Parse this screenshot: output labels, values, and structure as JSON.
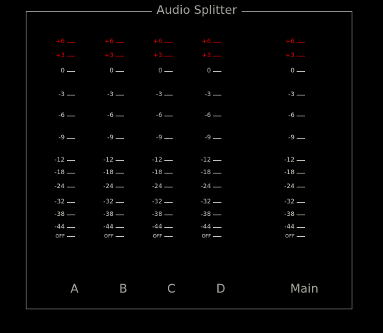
{
  "title": "Audio Splitter",
  "colors": {
    "background": "#000000",
    "frame": "#8f8f8f",
    "scale_text": "#c8c8c0",
    "peak_red": "#e00000",
    "label_text": "#a8a8a0"
  },
  "scale": [
    {
      "label": "+6",
      "red": true
    },
    {
      "label": "+3",
      "red": true
    },
    {
      "label": "0",
      "red": false
    },
    {
      "label": "-3",
      "red": false
    },
    {
      "label": "-6",
      "red": false
    },
    {
      "label": "-9",
      "red": false
    },
    {
      "label": "-12",
      "red": false
    },
    {
      "label": "-18",
      "red": false
    },
    {
      "label": "-24",
      "red": false
    },
    {
      "label": "-32",
      "red": false
    },
    {
      "label": "-38",
      "red": false
    },
    {
      "label": "-44",
      "red": false
    },
    {
      "label": "OFF",
      "red": false
    }
  ],
  "channels": [
    {
      "id": "a",
      "label": "A"
    },
    {
      "id": "b",
      "label": "B"
    },
    {
      "id": "c",
      "label": "C"
    },
    {
      "id": "d",
      "label": "D"
    },
    {
      "id": "main",
      "label": "Main"
    }
  ]
}
